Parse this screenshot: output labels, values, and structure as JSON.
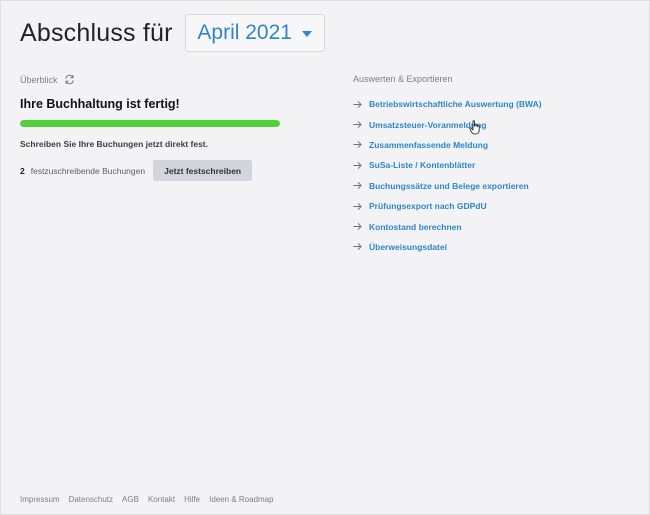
{
  "header": {
    "title": "Abschluss für",
    "month_selected": "April 2021"
  },
  "overview": {
    "label": "Überblick",
    "status": "Ihre Buchhaltung ist fertig!",
    "progress_percent": 100,
    "hint": "Schreiben Sie Ihre Buchungen jetzt direkt fest.",
    "pending_count": "2",
    "pending_label": "festzuschreibende Buchungen",
    "commit_button": "Jetzt festschreiben"
  },
  "export": {
    "label": "Auswerten & Exportieren",
    "links": [
      "Betriebswirtschaftliche Auswertung (BWA)",
      "Umsatzsteuer-Voranmeldung",
      "Zusammenfassende Meldung",
      "SuSa-Liste / Kontenblätter",
      "Buchungssätze und Belege exportieren",
      "Prüfungsexport nach GDPdU",
      "Kontostand berechnen",
      "Überweisungsdatei"
    ]
  },
  "footer": {
    "links": [
      "Impressum",
      "Datenschutz",
      "AGB",
      "Kontakt",
      "Hilfe",
      "Ideen & Roadmap"
    ]
  },
  "colors": {
    "accent": "#2e86c9",
    "progress": "#52d13b",
    "background": "#f3f3f6"
  },
  "icons": [
    "refresh-icon",
    "arrow-right-icon",
    "chevron-down-icon",
    "hand-pointer-icon"
  ]
}
